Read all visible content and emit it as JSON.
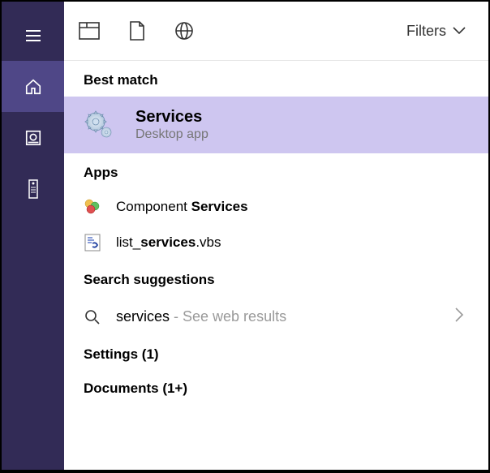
{
  "topbar": {
    "filters_label": "Filters"
  },
  "sections": {
    "best_match": "Best match",
    "apps": "Apps",
    "search_suggestions": "Search suggestions"
  },
  "best_match": {
    "title": "Services",
    "subtitle": "Desktop app"
  },
  "apps": [
    {
      "prefix": "Component ",
      "match": "Services",
      "suffix": ""
    },
    {
      "prefix": "list_",
      "match": "services",
      "suffix": ".vbs"
    }
  ],
  "suggestions": [
    {
      "term": "services",
      "hint": " - See web results"
    }
  ],
  "categories": {
    "settings": {
      "label": "Settings",
      "count": "(1)"
    },
    "documents": {
      "label": "Documents",
      "count": "(1+)"
    }
  }
}
